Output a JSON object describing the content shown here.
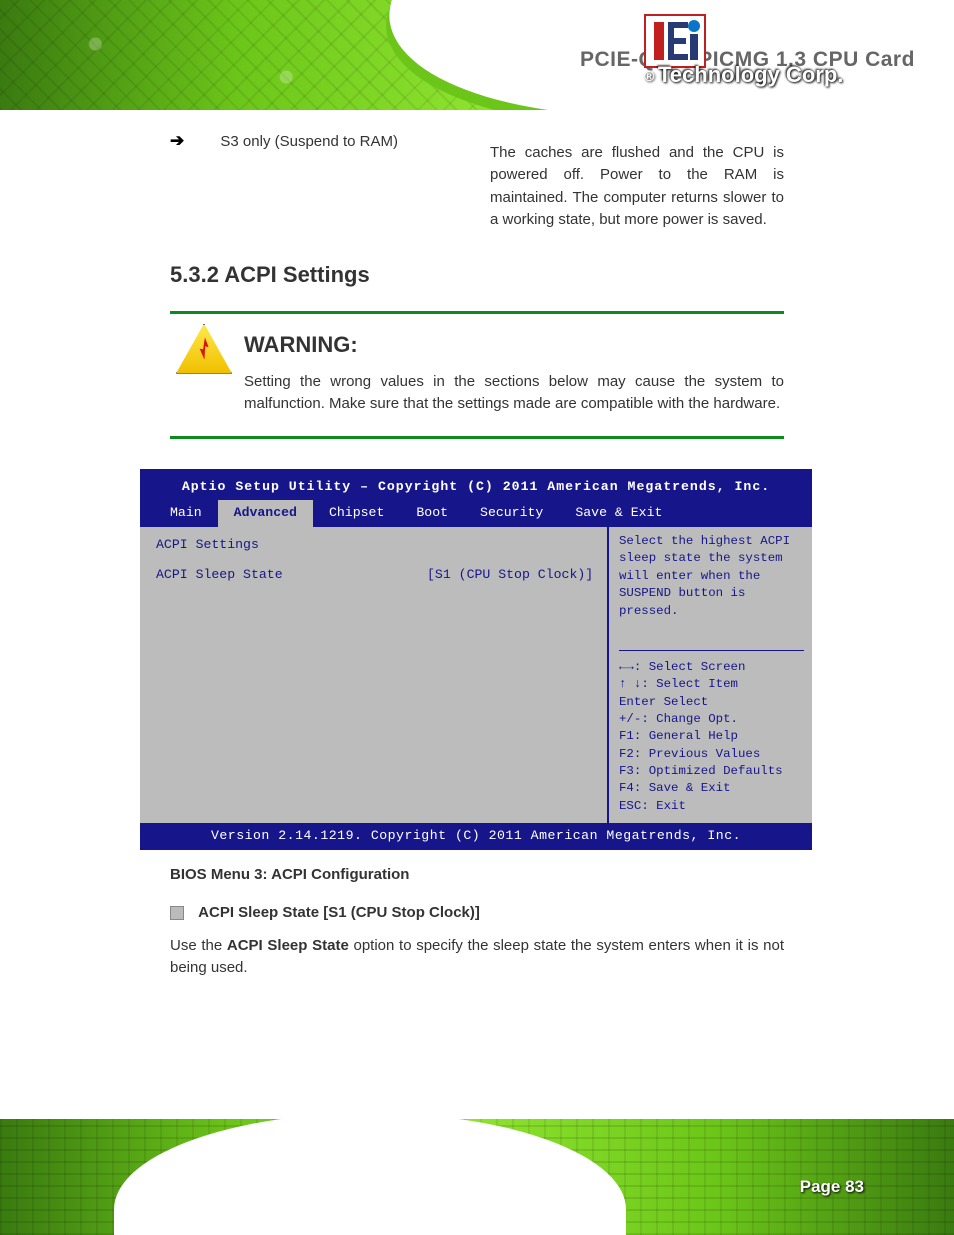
{
  "brand": {
    "reg": "®",
    "name": "Technology Corp."
  },
  "header_title": "PCIE-Q670 PICMG 1.3 CPU Card",
  "s3suspend": {
    "term": "S3 only (Suspend to RAM)",
    "desc": "The caches are flushed and the CPU is powered off. Power to the RAM is maintained. The computer returns slower to a working state, but more power is saved."
  },
  "section_title": "5.3.2 ACPI Settings",
  "warning": {
    "title": "WARNING:",
    "text": "Setting the wrong values in the sections below may cause the system to malfunction. Make sure that the settings made are compatible with the hardware."
  },
  "bios": {
    "title": "Aptio Setup Utility – Copyright (C) 2011 American Megatrends, Inc.",
    "tabs": [
      "Main",
      "Advanced",
      "Chipset",
      "Boot",
      "Security",
      "Save & Exit"
    ],
    "active_tab_index": 1,
    "left_heading": "ACPI Settings",
    "items": [
      {
        "k": "ACPI Sleep State",
        "v": "[S1 (CPU Stop Clock)]"
      }
    ],
    "right_top": "Select the highest ACPI sleep state the system will enter when the SUSPEND button is pressed.",
    "keys": [
      {
        "sym": "←→",
        "label": ": Select Screen"
      },
      {
        "sym": "↑ ↓",
        "label": ": Select Item"
      },
      {
        "sym": "Enter",
        "label": "Select"
      },
      {
        "sym": "+/-",
        "label": ": Change Opt."
      },
      {
        "sym": "F1",
        "label": ": General Help"
      },
      {
        "sym": "F2",
        "label": ": Previous Values"
      },
      {
        "sym": "F3",
        "label": ": Optimized Defaults"
      },
      {
        "sym": "F4",
        "label": ": Save & Exit"
      },
      {
        "sym": "ESC",
        "label": ": Exit"
      }
    ],
    "footer": "Version 2.14.1219. Copyright (C) 2011 American Megatrends, Inc."
  },
  "figure_caption": "BIOS Menu 3: ACPI Configuration",
  "acpi_option": {
    "heading": "ACPI Sleep State [S1 (CPU Stop Clock)]",
    "body_1": "Use the ",
    "body_bold": "ACPI Sleep State",
    "body_2": " option to specify the sleep state the system enters when it is not being used."
  },
  "page_label": "Page 83"
}
